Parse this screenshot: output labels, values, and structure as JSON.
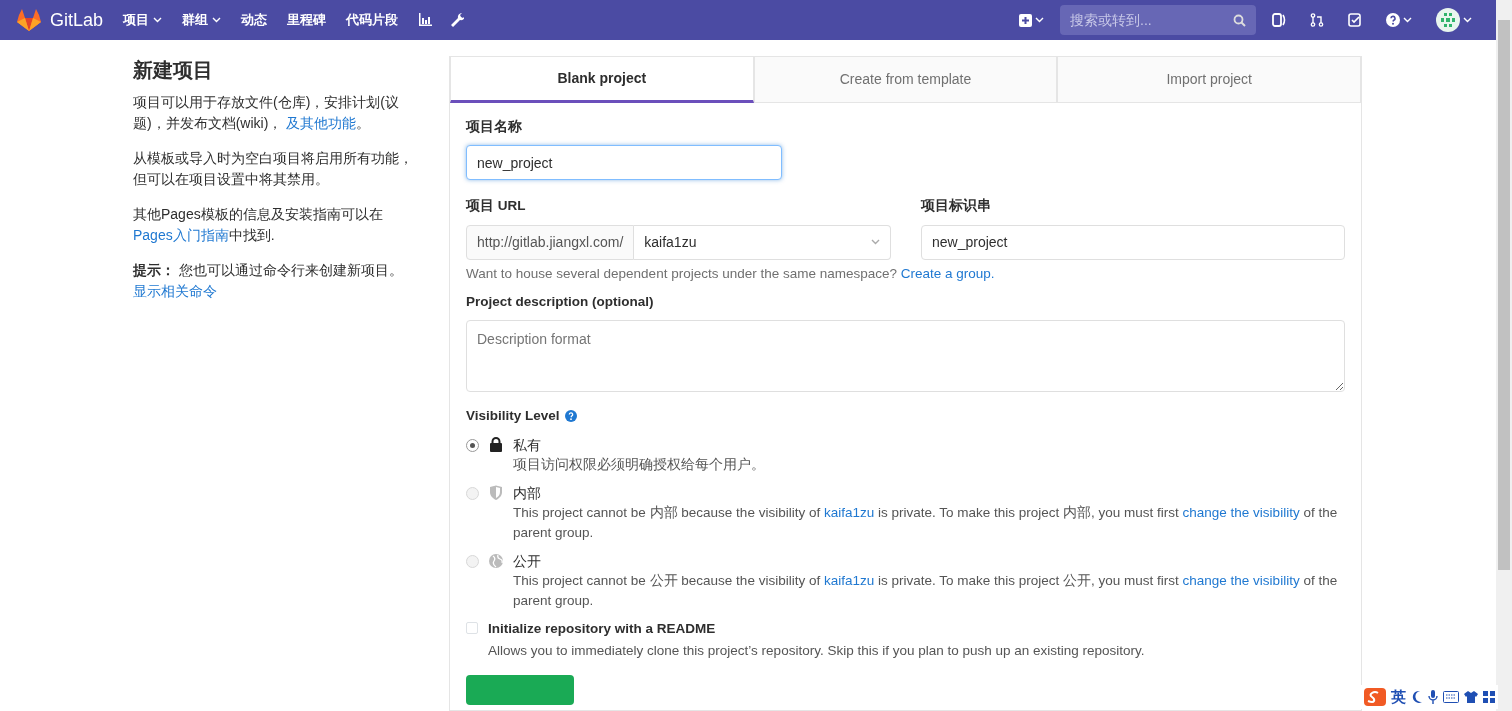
{
  "navbar": {
    "brand": "GitLab",
    "menu": [
      {
        "label": "项目",
        "dropdown": true
      },
      {
        "label": "群组",
        "dropdown": true
      },
      {
        "label": "动态",
        "dropdown": false
      },
      {
        "label": "里程碑",
        "dropdown": false
      },
      {
        "label": "代码片段",
        "dropdown": false
      }
    ],
    "search_placeholder": "搜索或转到..."
  },
  "sidebar": {
    "title": "新建项目",
    "paragraphs": [
      [
        {
          "kind": "text",
          "text": "项目可以用于存放文件(仓库)，安排计划(议题)，并发布文档(wiki)， "
        },
        {
          "kind": "link",
          "text": "及其他功能"
        },
        {
          "kind": "text",
          "text": "。"
        }
      ],
      [
        {
          "kind": "text",
          "text": "从模板或导入时为空白项目将启用所有功能，但可以在项目设置中将其禁用。"
        }
      ],
      [
        {
          "kind": "text",
          "text": "其他Pages模板的信息及安装指南可以在"
        },
        {
          "kind": "link",
          "text": "Pages入门指南"
        },
        {
          "kind": "text",
          "text": "中找到."
        }
      ],
      [
        {
          "kind": "bold",
          "text": "提示："
        },
        {
          "kind": "text",
          "text": " 您也可以通过命令行来创建新项目。 "
        },
        {
          "kind": "link",
          "text": "显示相关命令"
        }
      ]
    ]
  },
  "tabs": [
    {
      "label": "Blank project",
      "selected": true
    },
    {
      "label": "Create from template",
      "selected": false
    },
    {
      "label": "Import project",
      "selected": false
    }
  ],
  "form": {
    "name_label": "项目名称",
    "name_value": "new_project",
    "url_label": "项目 URL",
    "url_prefix": "http://gitlab.jiangxl.com/",
    "namespace": "kaifa1zu",
    "slug_label": "项目标识串",
    "slug_value": "new_project",
    "group_hint": [
      {
        "kind": "text",
        "text": "Want to house several dependent projects under the same namespace? "
      },
      {
        "kind": "link",
        "text": "Create a group."
      }
    ],
    "description_label": "Project description (optional)",
    "description_placeholder": "Description format",
    "visibility_label": "Visibility Level",
    "visibility_options": [
      {
        "kind": "private",
        "label": "私有",
        "selected": true,
        "disabled": false,
        "description": [
          {
            "kind": "text",
            "text": "项目访问权限必须明确授权给每个用户。"
          }
        ]
      },
      {
        "kind": "internal",
        "label": "内部",
        "selected": false,
        "disabled": true,
        "description": [
          {
            "kind": "text",
            "text": "This project cannot be 内部 because the visibility of "
          },
          {
            "kind": "link",
            "text": "kaifa1zu"
          },
          {
            "kind": "text",
            "text": " is private. To make this project 内部, you must first "
          },
          {
            "kind": "link",
            "text": "change the visibility"
          },
          {
            "kind": "text",
            "text": " of the parent group."
          }
        ]
      },
      {
        "kind": "public",
        "label": "公开",
        "selected": false,
        "disabled": true,
        "description": [
          {
            "kind": "text",
            "text": "This project cannot be 公开 because the visibility of "
          },
          {
            "kind": "link",
            "text": "kaifa1zu"
          },
          {
            "kind": "text",
            "text": " is private. To make this project 公开, you must first "
          },
          {
            "kind": "link",
            "text": "change the visibility"
          },
          {
            "kind": "text",
            "text": " of the parent group."
          }
        ]
      }
    ],
    "readme": {
      "label": "Initialize repository with a README",
      "hint": "Allows you to immediately clone this project’s repository. Skip this if you plan to push up an existing repository.",
      "checked": false
    }
  },
  "ime": {
    "label": "英"
  }
}
